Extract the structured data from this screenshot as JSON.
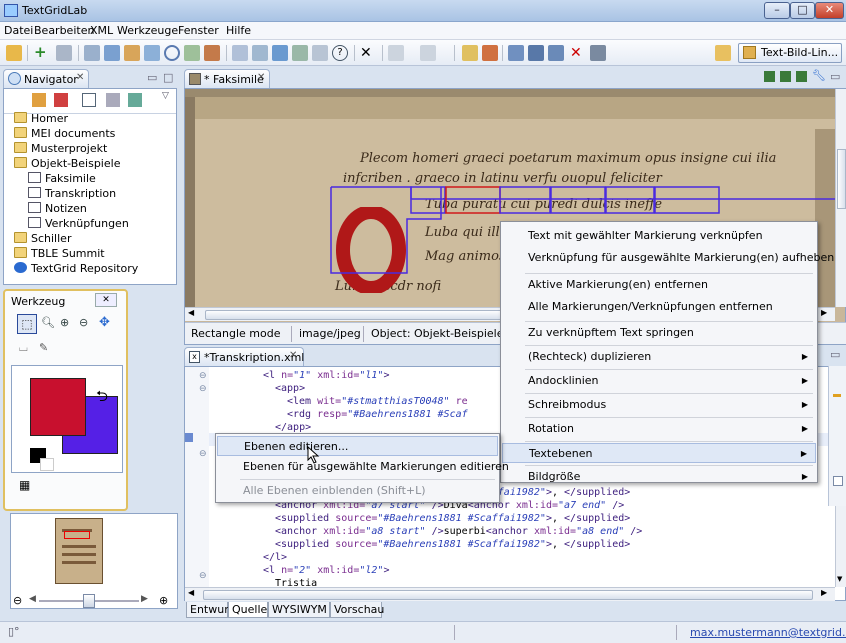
{
  "window": {
    "title": "TextGridLab"
  },
  "menu": [
    "Datei",
    "Bearbeiten",
    "XML",
    "Werkzeuge",
    "Fenster",
    "Hilfe"
  ],
  "toolbar": {
    "perspective_label": "Text-Bild-Lin..."
  },
  "navigator": {
    "tab": "Navigator",
    "tree": [
      {
        "label": "Homer",
        "level": 0
      },
      {
        "label": "MEI documents",
        "level": 0
      },
      {
        "label": "Musterprojekt",
        "level": 0
      },
      {
        "label": "Objekt-Beispiele",
        "level": 0
      },
      {
        "label": "Faksimile",
        "level": 1
      },
      {
        "label": "Transkription",
        "level": 1
      },
      {
        "label": "Notizen",
        "level": 1
      },
      {
        "label": "Verknüpfungen",
        "level": 1
      },
      {
        "label": "Schiller",
        "level": 0
      },
      {
        "label": "TBLE Summit",
        "level": 0
      },
      {
        "label": "TextGrid Repository",
        "level": 0
      }
    ]
  },
  "werkzeug": {
    "title": "Werkzeug",
    "primary_color": "#c8102e",
    "secondary_color": "#5520e6"
  },
  "faksimile": {
    "tab": "* Faksimile",
    "status": {
      "mode": "Rectangle mode",
      "mime": "image/jpeg",
      "object": "Object: Objekt-Beispiele/Verkn"
    },
    "manuscript_lines": [
      "Plecom homeri graeci poetarum maximum opus insigne cui ilia",
      "infcriben . graeco in latinu verfu ouopul feliciter",
      "Tuba puratu cui puredi dulcis ineffe",
      "Luba qui illa",
      "Mag animos",
      "Luratu scdr nofi"
    ],
    "drop_cap": "O"
  },
  "editor": {
    "tab": "*Transkription.xml",
    "lines": [
      {
        "indent": 7,
        "parts": [
          [
            "kw",
            "<l "
          ],
          [
            "at",
            "n="
          ],
          [
            "st",
            "\"1\""
          ],
          [
            "at",
            " xml:id="
          ],
          [
            "st",
            "\"l1\""
          ],
          [
            "kw",
            ">"
          ]
        ]
      },
      {
        "indent": 9,
        "parts": [
          [
            "kw",
            "<app>"
          ]
        ]
      },
      {
        "indent": 11,
        "parts": [
          [
            "kw",
            "<lem "
          ],
          [
            "at",
            "wit="
          ],
          [
            "st",
            "\"#stmatthiasT0048\""
          ],
          [
            "at",
            " re"
          ]
        ]
      },
      {
        "indent": 11,
        "parts": [
          [
            "kw",
            "<rdg "
          ],
          [
            "at",
            "resp="
          ],
          [
            "st",
            "\"#Baehrens1881 #Scaf"
          ]
        ]
      },
      {
        "indent": 9,
        "parts": [
          [
            "kw",
            "</app>"
          ]
        ]
      },
      {
        "indent": 0,
        "parts": [
          [
            "kw",
            ""
          ]
        ]
      },
      {
        "indent": 0,
        "parts": [
          [
            "kw",
            ""
          ]
        ]
      },
      {
        "indent": 0,
        "parts": [
          [
            "kw",
            ""
          ]
        ]
      },
      {
        "indent": 0,
        "parts": [
          [
            "kw",
            ""
          ]
        ]
      },
      {
        "indent": 9,
        "parts": [
          [
            "kw",
            "<supplied "
          ],
          [
            "at",
            "source="
          ],
          [
            "st",
            "\"#Baehrens1881 #Scaffai1982\""
          ],
          [
            "kw",
            ">"
          ],
          [
            "",
            ", "
          ],
          [
            "kw",
            "</supplied>"
          ]
        ]
      },
      {
        "indent": 9,
        "parts": [
          [
            "kw",
            "<anchor "
          ],
          [
            "at",
            "xml:id="
          ],
          [
            "st",
            "\"a7 start\""
          ],
          [
            "kw",
            " />"
          ],
          [
            "",
            "Diva"
          ],
          [
            "kw",
            "<anchor "
          ],
          [
            "at",
            "xml:id="
          ],
          [
            "st",
            "\"a7 end\""
          ],
          [
            "kw",
            " />"
          ]
        ]
      },
      {
        "indent": 9,
        "parts": [
          [
            "kw",
            "<supplied "
          ],
          [
            "at",
            "source="
          ],
          [
            "st",
            "\"#Baehrens1881 #Scaffai1982\""
          ],
          [
            "kw",
            ">"
          ],
          [
            "",
            ", "
          ],
          [
            "kw",
            "</supplied>"
          ]
        ]
      },
      {
        "indent": 9,
        "parts": [
          [
            "kw",
            "<anchor "
          ],
          [
            "at",
            "xml:id="
          ],
          [
            "st",
            "\"a8 start\""
          ],
          [
            "kw",
            " />"
          ],
          [
            "",
            "superbi"
          ],
          [
            "kw",
            "<anchor "
          ],
          [
            "at",
            "xml:id="
          ],
          [
            "st",
            "\"a8 end\""
          ],
          [
            "kw",
            " />"
          ]
        ]
      },
      {
        "indent": 9,
        "parts": [
          [
            "kw",
            "<supplied "
          ],
          [
            "at",
            "source="
          ],
          [
            "st",
            "\"#Baehrens1881 #Scaffai1982\""
          ],
          [
            "kw",
            ">"
          ],
          [
            "",
            ", "
          ],
          [
            "kw",
            "</supplied>"
          ]
        ]
      },
      {
        "indent": 7,
        "parts": [
          [
            "kw",
            "</l>"
          ]
        ]
      },
      {
        "indent": 7,
        "parts": [
          [
            "kw",
            "<l "
          ],
          [
            "at",
            "n="
          ],
          [
            "st",
            "\"2\""
          ],
          [
            "at",
            " xml:id="
          ],
          [
            "st",
            "\"l2\""
          ],
          [
            "kw",
            ">"
          ]
        ]
      },
      {
        "indent": 9,
        "parts": [
          [
            "",
            "Tristia"
          ]
        ]
      }
    ],
    "bottom_tabs": [
      "Entwurf",
      "Quelle",
      "WYSIWYM",
      "Vorschau"
    ]
  },
  "context_menu": {
    "items": [
      {
        "label": "Text mit gewählter Markierung verknüpfen",
        "sub": false
      },
      {
        "label": "Verknüpfung für ausgewählte Markierung(en) aufheben",
        "sub": false
      },
      {
        "label": "Aktive Markierung(en) entfernen",
        "sub": false
      },
      {
        "label": "Alle Markierungen/Verknüpfungen entfernen",
        "sub": false
      },
      {
        "label": "Zu verknüpftem Text springen",
        "sub": false
      },
      {
        "label": "(Rechteck) duplizieren",
        "sub": true
      },
      {
        "label": "Andocklinien",
        "sub": true
      },
      {
        "label": "Schreibmodus",
        "sub": true
      },
      {
        "label": "Rotation",
        "sub": true
      },
      {
        "label": "Textebenen",
        "sub": true
      },
      {
        "label": "Bildgröße",
        "sub": true
      }
    ]
  },
  "submenu": {
    "items": [
      {
        "label": "Ebenen editieren...",
        "disabled": false
      },
      {
        "label": "Ebenen für ausgewählte Markierungen editieren",
        "disabled": false
      },
      {
        "label": "Alle Ebenen einblenden (Shift+L)",
        "disabled": true
      }
    ]
  },
  "statusbar": {
    "user": "max.mustermann@textgrid.de"
  }
}
